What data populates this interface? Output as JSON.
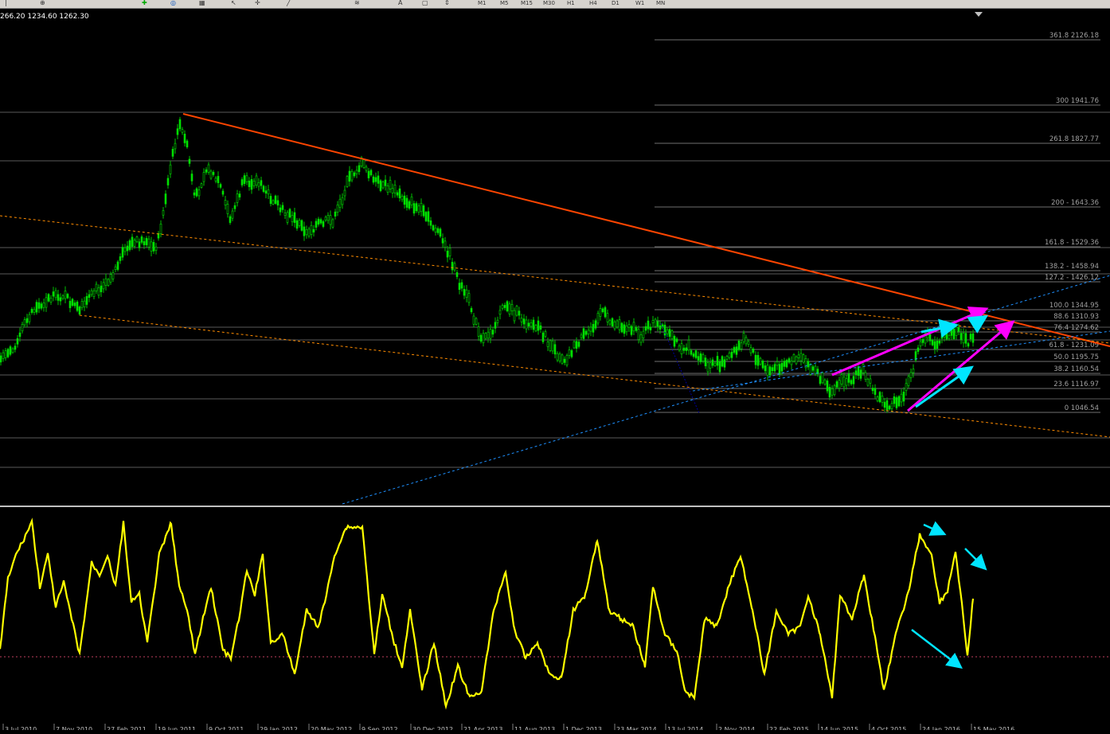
{
  "ohlc_header": "266.20 1234.60 1262.30",
  "toolbar": {
    "timeframes": [
      "M1",
      "M5",
      "M15",
      "M30",
      "H1",
      "H4",
      "D1",
      "W1",
      "MN"
    ]
  },
  "fib_levels": [
    {
      "label": "361.8 2126.18"
    },
    {
      "label": "300 1941.76"
    },
    {
      "label": "261.8 1827.77"
    },
    {
      "label": "200 - 1643.36"
    },
    {
      "label": "161.8 - 1529.36"
    },
    {
      "label": "138.2 - 1458.94"
    },
    {
      "label": "127.2 - 1426.12"
    },
    {
      "label": "100.0 1344.95"
    },
    {
      "label": "88.6 1310.93"
    },
    {
      "label": "76.4 1274.62"
    },
    {
      "label": "61.8 - 1231.09"
    },
    {
      "label": "50.0 1195.75"
    },
    {
      "label": "38.2 1160.54"
    },
    {
      "label": "23.6 1116.97"
    },
    {
      "label": "0 1046.54"
    }
  ],
  "date_axis": [
    "3 Jul 2010",
    "7 Nov 2010",
    "27 Feb 2011",
    "19 Jun 2011",
    "9 Oct 2011",
    "29 Jan 2012",
    "20 May 2012",
    "9 Sep 2012",
    "30 Dec 2012",
    "21 Apr 2013",
    "11 Aug 2013",
    "1 Dec 2013",
    "23 Mar 2014",
    "13 Jul 2014",
    "2 Nov 2014",
    "22 Feb 2015",
    "14 Jun 2015",
    "4 Oct 2015",
    "24 Jan 2016",
    "15 May 2016"
  ],
  "colors": {
    "candle": "#00e000",
    "trendline": "#ff4500",
    "channel": "#ff8c00",
    "blue_trend": "#1e90ff",
    "fib": "#808080",
    "oscillator": "#ffff00",
    "magenta": "#ff00ff",
    "cyan": "#00e5ff",
    "zero_line": "#c04060"
  },
  "icons": [
    "new-order-icon",
    "zoom-in-icon",
    "zoom-out-icon",
    "refresh-icon",
    "chart-icon",
    "cursor-icon",
    "crosshair-icon",
    "line-icon",
    "fib-icon",
    "text-icon",
    "label-icon",
    "arrow-icon"
  ]
}
